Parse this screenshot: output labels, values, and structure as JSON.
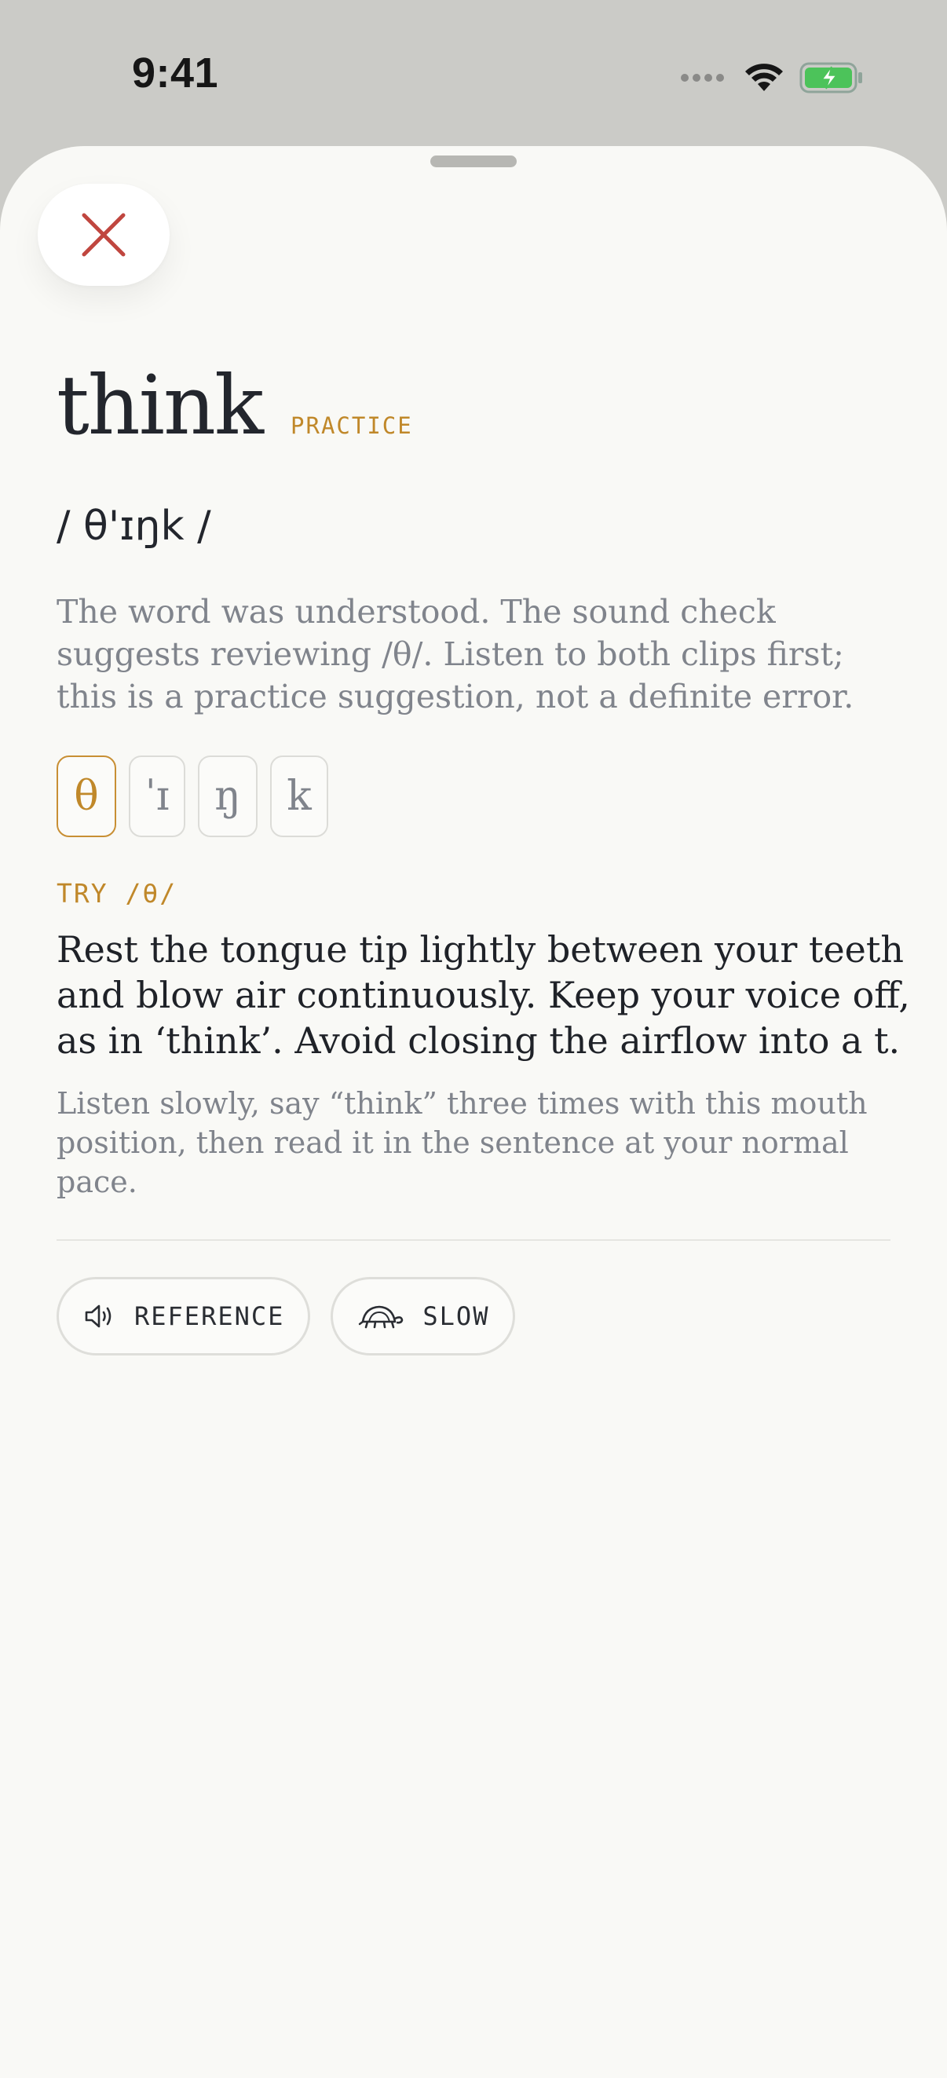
{
  "status_bar": {
    "time": "9:41"
  },
  "sheet": {
    "close_icon": "close-icon"
  },
  "word": {
    "text": "think",
    "badge": "PRACTICE",
    "ipa": "/ θ'ɪŋk /"
  },
  "summary": "The word was understood. The sound check suggests reviewing /θ/. Listen to both clips first; this is a practice suggestion, not a definite error.",
  "phonemes": [
    {
      "symbol": "θ",
      "selected": true
    },
    {
      "symbol": "ˈɪ",
      "selected": false
    },
    {
      "symbol": "ŋ",
      "selected": false
    },
    {
      "symbol": "k",
      "selected": false
    }
  ],
  "tip": {
    "label": "TRY /θ/",
    "instruction": "Rest the tongue tip lightly between your teeth and blow air continuously. Keep your voice off, as in ‘think’. Avoid closing the airflow into a t.",
    "hint": "Listen slowly, say “think” three times with this mouth position, then read it in the sentence at your normal pace."
  },
  "audio_buttons": {
    "reference": {
      "label": "REFERENCE",
      "icon": "speaker-icon"
    },
    "slow": {
      "label": "SLOW",
      "icon": "turtle-icon"
    }
  },
  "colors": {
    "accent": "#c0882a",
    "close": "#c0463f",
    "battery": "#4cc35a"
  }
}
